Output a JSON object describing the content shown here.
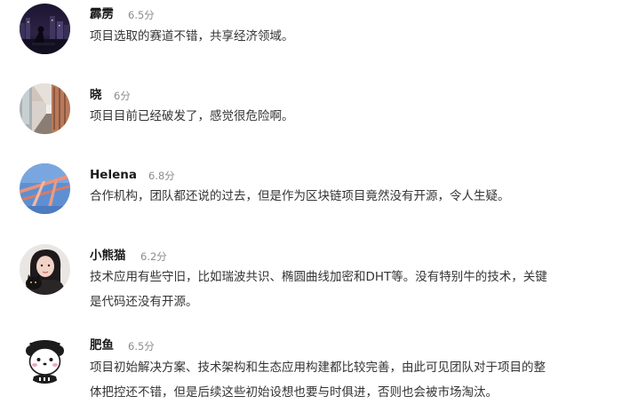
{
  "comments": [
    {
      "name": "霹雳",
      "score": "6.5分",
      "lines": [
        "项目选取的赛道不错，共享经济领域。"
      ]
    },
    {
      "name": "晓",
      "score": "6分",
      "lines": [
        "项目目前已经破发了，感觉很危险啊。"
      ]
    },
    {
      "name": "Helena",
      "score": "6.8分",
      "lines": [
        "合作机构，团队都还说的过去，但是作为区块链项目竟然没有开源，令人生疑。"
      ]
    },
    {
      "name": "小熊猫",
      "score": "6.2分",
      "lines": [
        "技术应用有些守旧，比如瑞波共识、椭圆曲线加密和DHT等。没有特别牛的技术，关键",
        "是代码还没有开源。"
      ]
    },
    {
      "name": "肥鱼",
      "score": "6.5分",
      "lines": [
        "项目初始解决方案、技术架构和生态应用构建都比较完善，由此可见团队对于项目的整",
        "体把控还不错，但是后续这些初始设想也要与时俱进，否则也会被市场淘汰。"
      ]
    }
  ],
  "avatars": [
    {
      "icon": "night-city-photo-avatar"
    },
    {
      "icon": "corridor-photo-avatar"
    },
    {
      "icon": "sky-structure-photo-avatar"
    },
    {
      "icon": "girl-with-cat-photo-avatar"
    },
    {
      "icon": "panda-cartoon-avatar"
    }
  ]
}
